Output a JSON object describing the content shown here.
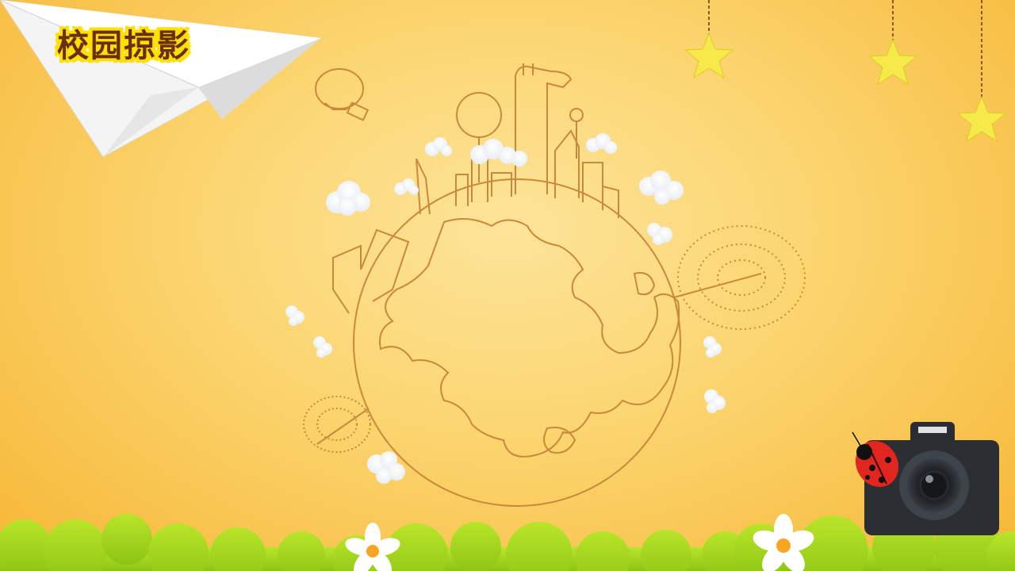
{
  "slide": {
    "title": "校园掠影"
  },
  "colors": {
    "background": "#fbd46e",
    "line_art": "#c8893a",
    "title_text": "#6b2e0c",
    "title_outline": "#ffe000",
    "grass": "#a3d71e",
    "star": "#f6ea4a"
  },
  "icons": [
    "paper-plane-icon",
    "hanging-star-icon",
    "globe-illustration",
    "camera-icon",
    "ladybug-icon",
    "flower-icon",
    "cloud-icon",
    "hot-air-balloon-icon",
    "giraffe-icon",
    "tree-icon"
  ]
}
